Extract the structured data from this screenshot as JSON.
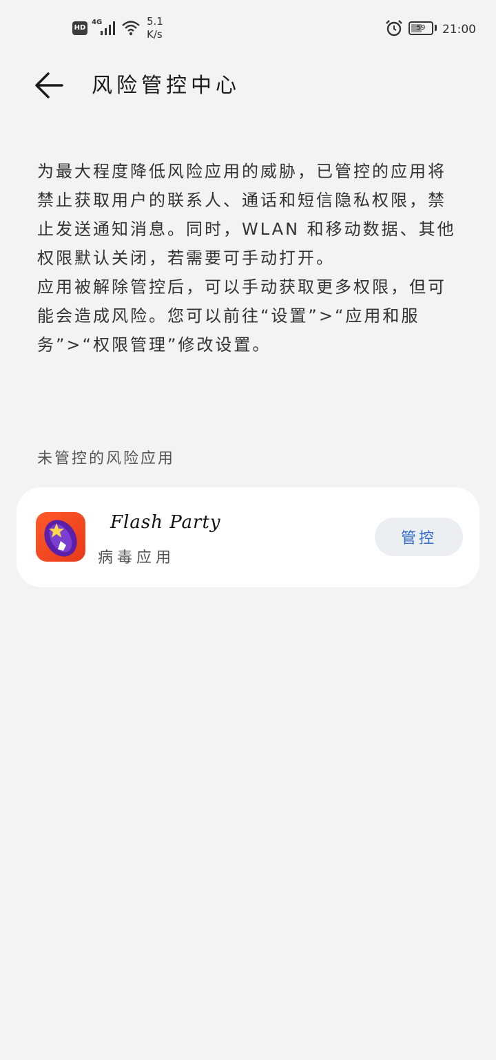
{
  "status_bar": {
    "hd": "HD",
    "network": "4G",
    "speed_value": "5.1",
    "speed_unit": "K/s",
    "battery_level": "59",
    "time": "21:00"
  },
  "header": {
    "title": "风险管控中心"
  },
  "description": {
    "paragraph_1": "为最大程度降低风险应用的威胁，已管控的应用将禁止获取用户的联系人、通话和短信隐私权限，禁止发送通知消息。同时，WLAN 和移动数据、其他权限默认关闭，若需要可手动打开。",
    "paragraph_2": "应用被解除管控后，可以手动获取更多权限，但可能会造成风险。您可以前往“设置”>“应用和服务”>“权限管理”修改设置。"
  },
  "section": {
    "label": "未管控的风险应用"
  },
  "apps": [
    {
      "name": "Flash Party",
      "tag": "病毒应用",
      "action_label": "管控"
    }
  ],
  "colors": {
    "background": "#f1f3f5",
    "card": "#ffffff",
    "accent": "#2f6ccf"
  }
}
